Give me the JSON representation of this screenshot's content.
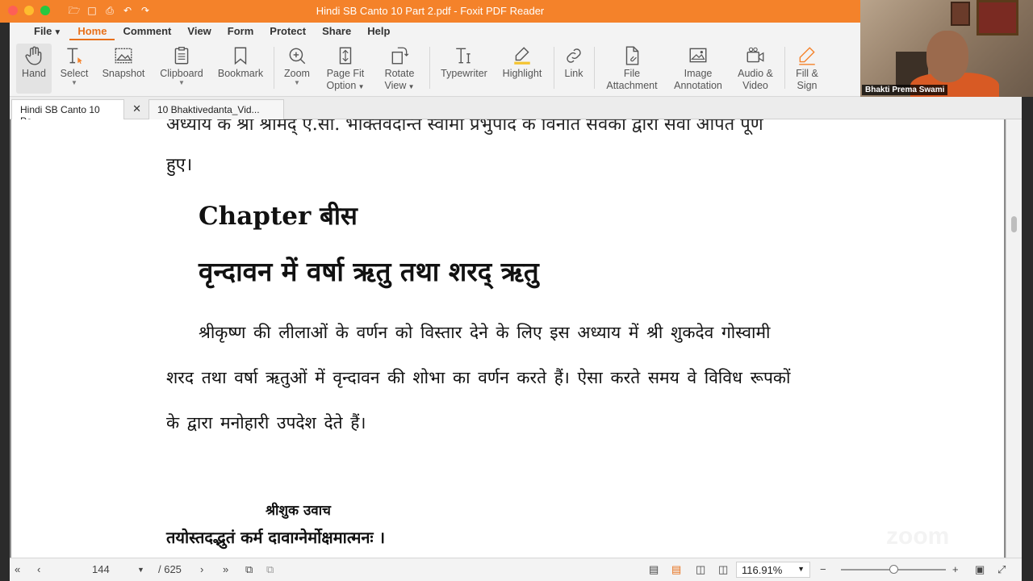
{
  "window": {
    "title": "Hindi SB Canto 10 Part 2.pdf - Foxit PDF Reader"
  },
  "menu": {
    "items": [
      {
        "label": "File",
        "name": "menu-file"
      },
      {
        "label": "Home",
        "name": "menu-home"
      },
      {
        "label": "Comment",
        "name": "menu-comment"
      },
      {
        "label": "View",
        "name": "menu-view"
      },
      {
        "label": "Form",
        "name": "menu-form"
      },
      {
        "label": "Protect",
        "name": "menu-protect"
      },
      {
        "label": "Share",
        "name": "menu-share"
      },
      {
        "label": "Help",
        "name": "menu-help"
      }
    ],
    "file_caret": "⌄"
  },
  "ribbon": {
    "hand": "Hand",
    "select": "Select",
    "snapshot": "Snapshot",
    "clipboard": "Clipboard",
    "bookmark": "Bookmark",
    "zoom": "Zoom",
    "page_fit_1": "Page Fit",
    "page_fit_2": "Option",
    "rotate_1": "Rotate",
    "rotate_2": "View",
    "typewriter": "Typewriter",
    "highlight": "Highlight",
    "link": "Link",
    "file_att_1": "File",
    "file_att_2": "Attachment",
    "image_ann_1": "Image",
    "image_ann_2": "Annotation",
    "audio_1": "Audio &",
    "audio_2": "Video",
    "fill_1": "Fill &",
    "fill_2": "Sign"
  },
  "tabs": [
    {
      "label": "Hindi SB Canto 10 Pa...",
      "active": true
    },
    {
      "label": "10 Bhaktivedanta_Vid...",
      "active": false
    }
  ],
  "document": {
    "line_top": "अध्याय के श्री श्रीमद् ए.सी. भक्तिवेदान्त स्वामी प्रभुपाद के विनीत सेवकों द्वारा सेवा अर्पित पूर्ण",
    "line_hue": "हुए।",
    "chapter": "Chapter बीस",
    "heading": "वृन्दावन में वर्षा ऋतु तथा शरद् ऋतु",
    "para_1": "श्रीकृष्ण की लीलाओं के वर्णन को विस्तार देने के लिए इस अध्याय में श्री शुकदेव गोस्वामी",
    "para_2": "शरद तथा वर्षा ऋतुओं में वृन्दावन की शोभा का वर्णन करते हैं। ऐसा करते समय वे विविध रूपकों",
    "para_3": "के द्वारा मनोहारी उपदेश देते हैं।",
    "speaker": "श्रीशुक उवाच",
    "verse": "तयोस्तदद्भुतं कर्म दावाग्नेर्मोक्षमात्मनः ।"
  },
  "status": {
    "page_current": "144",
    "page_total": "/ 625",
    "zoom": "116.91%"
  },
  "webcam": {
    "participant_name": "Bhakti Prema Swami"
  },
  "watermark": "zoom",
  "colors": {
    "accent": "#f4822a",
    "active_tab": "#e8701a"
  }
}
